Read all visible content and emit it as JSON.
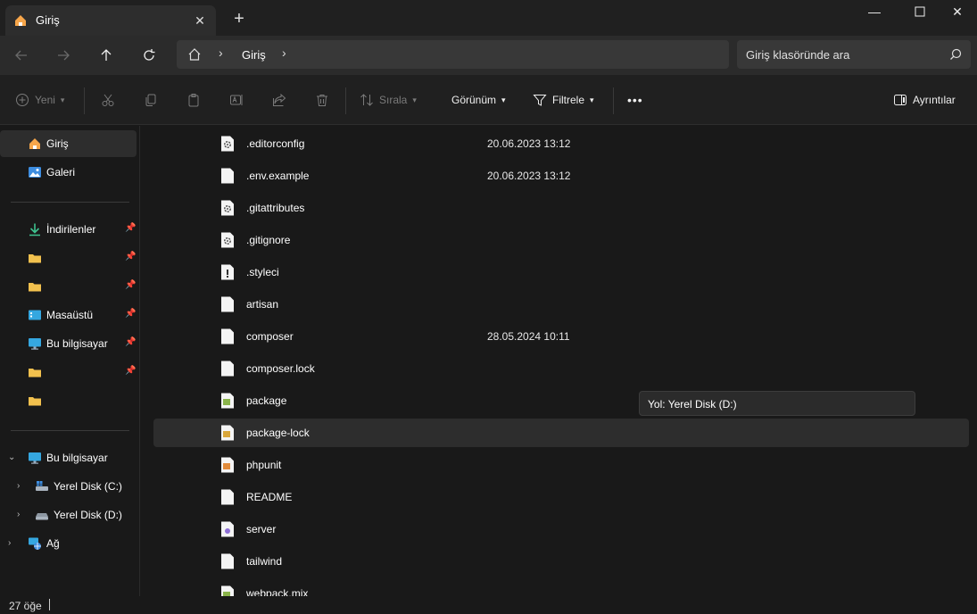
{
  "window": {
    "tab_title": "Giriş",
    "tab_icon": "home-icon",
    "controls": [
      "minimize-icon",
      "maximize-icon",
      "close-icon"
    ]
  },
  "nav": {
    "address_home_icon": "home-icon",
    "address_segment": "Giriş",
    "search_placeholder": "Giriş klasöründe ara"
  },
  "toolbar": {
    "new_label": "Yeni",
    "sort_label": "Sırala",
    "view_label": "Görünüm",
    "filter_label": "Filtrele",
    "more_label": "•••",
    "details_label": "Ayrıntılar"
  },
  "sidebar": {
    "home": "Giriş",
    "gallery": "Galeri",
    "quick": [
      {
        "label": "İndirilenler",
        "icon": "download-icon",
        "pinned": true
      },
      {
        "label": "",
        "icon": "folder-icon",
        "pinned": true
      },
      {
        "label": "",
        "icon": "folder-icon",
        "pinned": true
      },
      {
        "label": "Masaüstü",
        "icon": "desktop-icon",
        "pinned": true
      },
      {
        "label": "Bu bilgisayar",
        "icon": "computer-icon",
        "pinned": true
      },
      {
        "label": "",
        "icon": "folder-icon",
        "pinned": true
      },
      {
        "label": "",
        "icon": "folder-icon",
        "pinned": false
      }
    ],
    "this_pc": "Bu bilgisayar",
    "drive_c": "Yerel Disk (C:)",
    "drive_d": "Yerel Disk (D:)",
    "network": "Ağ"
  },
  "files": [
    {
      "name": ".editorconfig",
      "date": "20.06.2023 13:12",
      "icon": "settings-file-icon"
    },
    {
      "name": ".env.example",
      "date": "20.06.2023 13:12",
      "icon": "file-icon"
    },
    {
      "name": ".gitattributes",
      "date": "",
      "icon": "settings-file-icon"
    },
    {
      "name": ".gitignore",
      "date": "",
      "icon": "settings-file-icon"
    },
    {
      "name": ".styleci",
      "date": "",
      "icon": "warning-file-icon"
    },
    {
      "name": "artisan",
      "date": "",
      "icon": "file-icon"
    },
    {
      "name": "composer",
      "date": "28.05.2024 10:11",
      "icon": "file-icon"
    },
    {
      "name": "composer.lock",
      "date": "",
      "icon": "file-icon"
    },
    {
      "name": "package",
      "date": "",
      "icon": "file-icon"
    },
    {
      "name": "package-lock",
      "date": "",
      "icon": "file-icon"
    },
    {
      "name": "phpunit",
      "date": "",
      "icon": "file-icon"
    },
    {
      "name": "README",
      "date": "",
      "icon": "file-icon"
    },
    {
      "name": "server",
      "date": "",
      "icon": "file-icon"
    },
    {
      "name": "tailwind",
      "date": "",
      "icon": "file-icon"
    },
    {
      "name": "webpack.mix",
      "date": "",
      "icon": "file-icon"
    }
  ],
  "tooltip": "Yol: Yerel Disk (D:)",
  "status": {
    "count": "27 öğe"
  }
}
